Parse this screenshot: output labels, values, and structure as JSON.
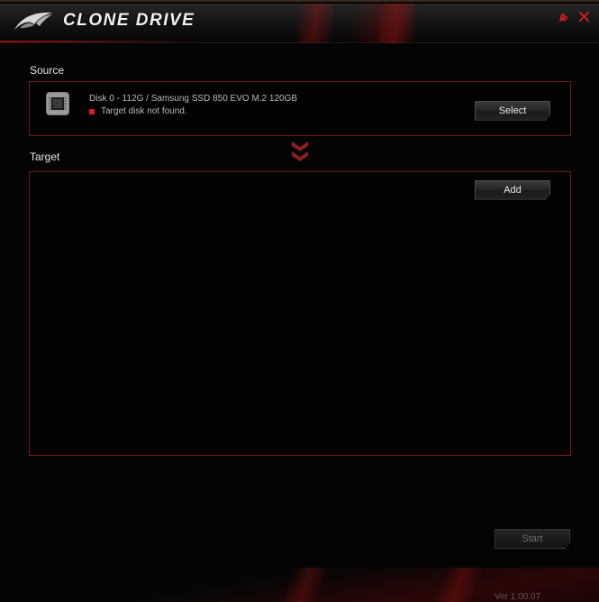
{
  "app": {
    "title": "CLONE DRIVE",
    "version": "Ver 1.00.07"
  },
  "titlebar": {
    "icons": [
      "rog-logo-icon",
      "wrench-icon",
      "close-icon"
    ]
  },
  "source": {
    "label": "Source",
    "disk_name": "Disk 0 - 112G / Samsung SSD 850 EVO M.2 120GB",
    "status_text": "Target disk not found.",
    "status_color": "#e01a1a",
    "select_label": "Select"
  },
  "target": {
    "label": "Target",
    "add_label": "Add"
  },
  "actions": {
    "start_label": "Start"
  },
  "colors": {
    "accent": "#b01818",
    "panel_border": "#6e1a1a",
    "background": "#040404"
  }
}
